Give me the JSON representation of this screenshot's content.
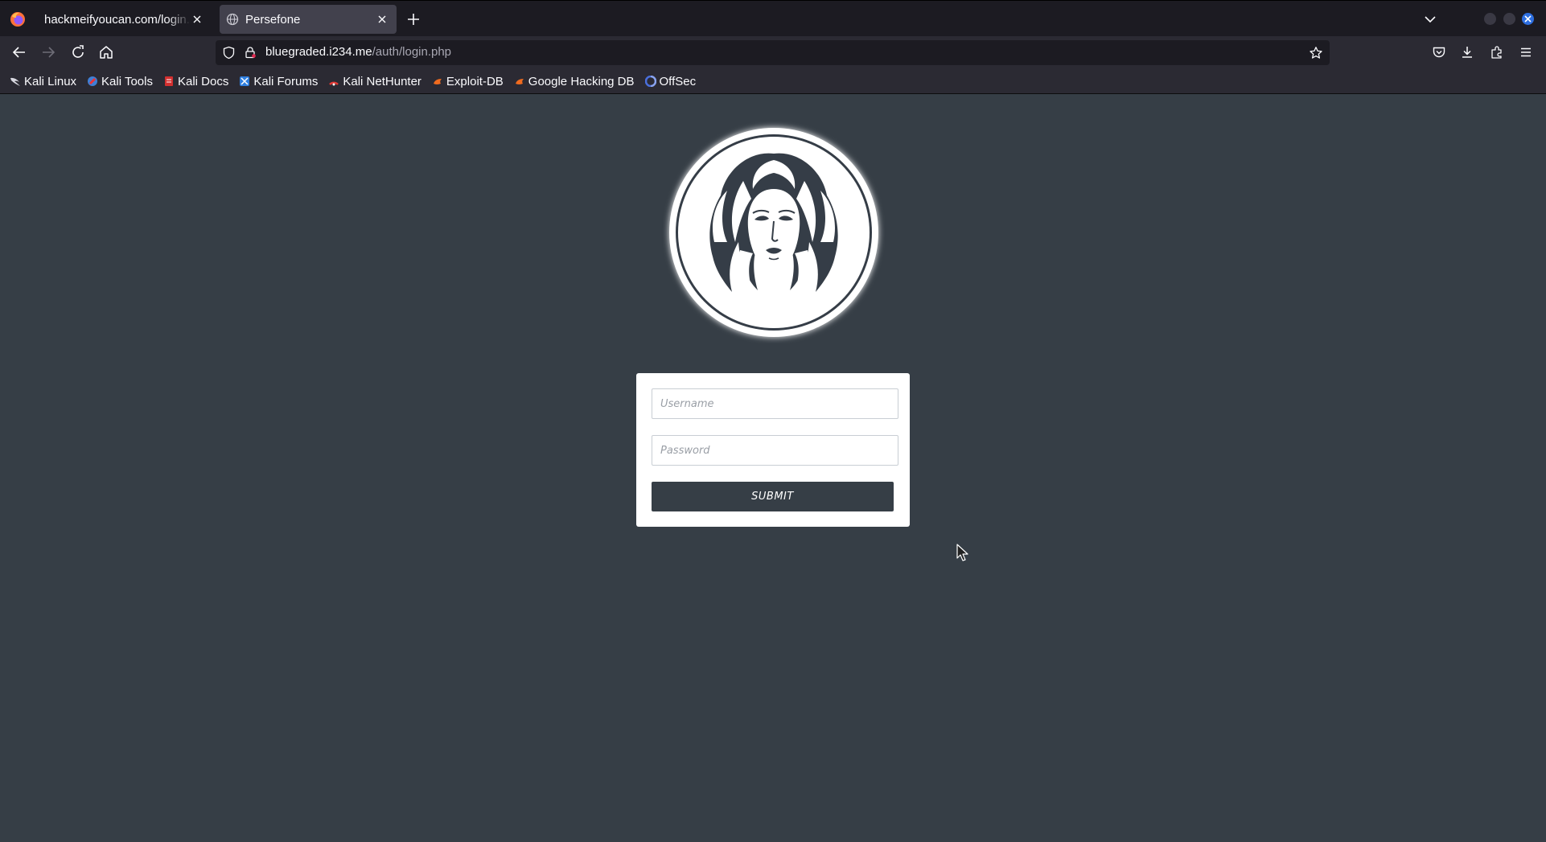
{
  "browser": {
    "tabs": [
      {
        "title": "hackmeifyoucan.com/login.php",
        "active": false
      },
      {
        "title": "Persefone",
        "active": true
      }
    ],
    "url": {
      "host": "bluegraded.i234.me",
      "path": "/auth/login.php"
    },
    "bookmarks": [
      {
        "label": "Kali Linux",
        "icon": "kali-dragon-icon"
      },
      {
        "label": "Kali Tools",
        "icon": "kali-tools-icon"
      },
      {
        "label": "Kali Docs",
        "icon": "kali-docs-icon"
      },
      {
        "label": "Kali Forums",
        "icon": "kali-forums-icon"
      },
      {
        "label": "Kali NetHunter",
        "icon": "nethunter-icon"
      },
      {
        "label": "Exploit-DB",
        "icon": "exploit-db-icon"
      },
      {
        "label": "Google Hacking DB",
        "icon": "ghdb-icon"
      },
      {
        "label": "OffSec",
        "icon": "offsec-icon"
      }
    ]
  },
  "login": {
    "username_placeholder": "Username",
    "password_placeholder": "Password",
    "submit_label": "SUBMIT"
  },
  "colors": {
    "page_bg": "#363e46",
    "card_bg": "#ffffff",
    "button_bg": "#363e46",
    "tab_strip": "#1c1b22",
    "toolbar": "#2b2a33"
  }
}
